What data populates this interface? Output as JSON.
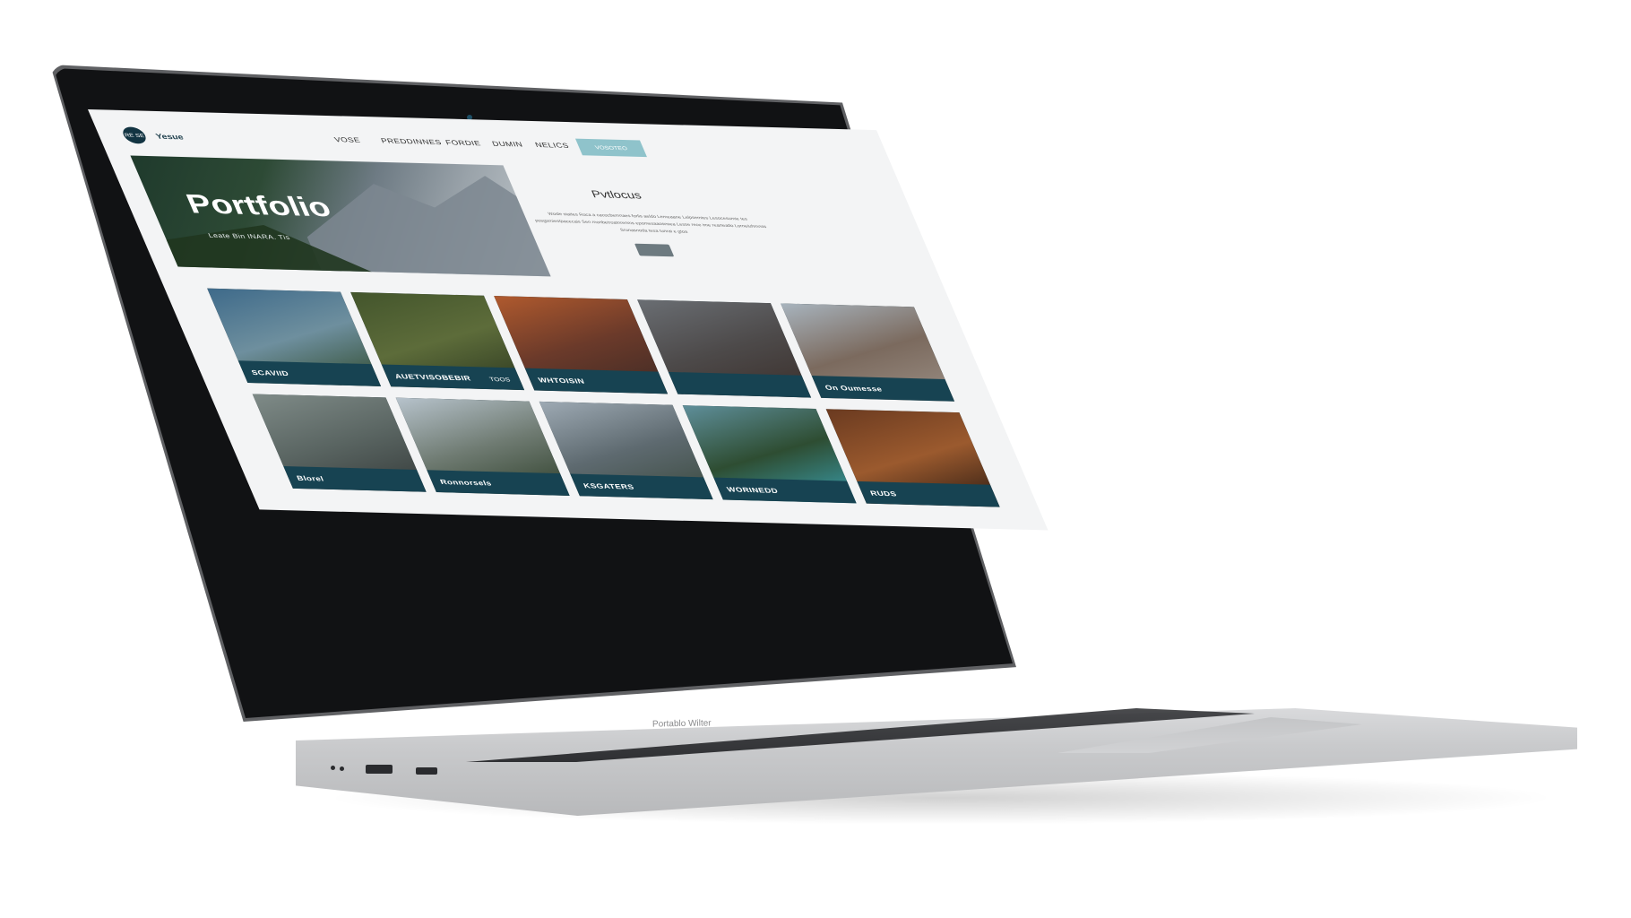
{
  "device": {
    "chin_label": "Portablo Wilter"
  },
  "site": {
    "logo_text": "RE SE",
    "brand": "Yesue",
    "nav": [
      "VOSE",
      "PREDDINNES",
      "FORDIE",
      "DUMIN",
      "NELICS"
    ],
    "nav_cta": "VOSOTEO"
  },
  "hero": {
    "title": "Portfolio",
    "subtitle": "Leate Bin INARA. Tis"
  },
  "about": {
    "title": "Pvtlocus",
    "text": "Wosle staites Roca a cacocbemnaes forlis aeldo Lemeaane Lelpsemtes Lesocesumie tes posgsmiestpacecais Sen monbetroatnrenms epomesaaosnsea Lesse rece ime rearteatlo Lorneiuhmnss Srunasnoda tesa tunrai e gtoa",
    "button": "—"
  },
  "gallery": [
    {
      "label": "SCAVIID",
      "label2": "",
      "colors": [
        "#3e6a8a",
        "#6e8f9e",
        "#2f4a2c"
      ]
    },
    {
      "label": "AUETVISOBEBIR",
      "label2": "TOOS",
      "colors": [
        "#43552c",
        "#5d6c3a",
        "#2c3820"
      ]
    },
    {
      "label": "WHTOISIN",
      "label2": "",
      "colors": [
        "#b05a2e",
        "#6b3a2a",
        "#3e2a25"
      ]
    },
    {
      "label": "",
      "label2": "",
      "colors": [
        "#6a6e73",
        "#4d4a4a",
        "#3a2f2b"
      ]
    },
    {
      "label": "On Oumesse",
      "label2": "",
      "colors": [
        "#a8b4be",
        "#7b6a5e",
        "#9b8f85"
      ]
    },
    {
      "label": "Blorel",
      "label2": "",
      "colors": [
        "#7f8b88",
        "#5a6562",
        "#353b3a"
      ]
    },
    {
      "label": "Ronnorsels",
      "label2": "",
      "colors": [
        "#b7c3cc",
        "#6f7b72",
        "#2e3f2a"
      ]
    },
    {
      "label": "KSGATERS",
      "label2": "",
      "colors": [
        "#9eaab4",
        "#5e6a70",
        "#3b4a3f"
      ]
    },
    {
      "label": "WORINEDD",
      "label2": "",
      "colors": [
        "#5f8f9b",
        "#2e4d32",
        "#3aa0b0"
      ]
    },
    {
      "label": "RUDS",
      "label2": "",
      "colors": [
        "#6a3a20",
        "#9b5a2e",
        "#2a1a12"
      ]
    }
  ]
}
